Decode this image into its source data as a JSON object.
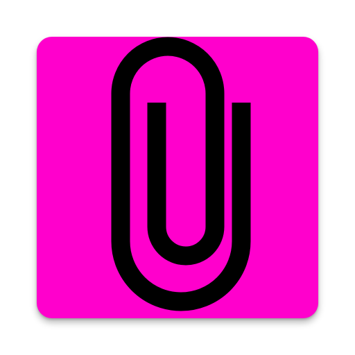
{
  "app_icon": {
    "icon": "paperclip-icon",
    "background_color": "#FF00CC",
    "glyph_color": "#000000"
  }
}
